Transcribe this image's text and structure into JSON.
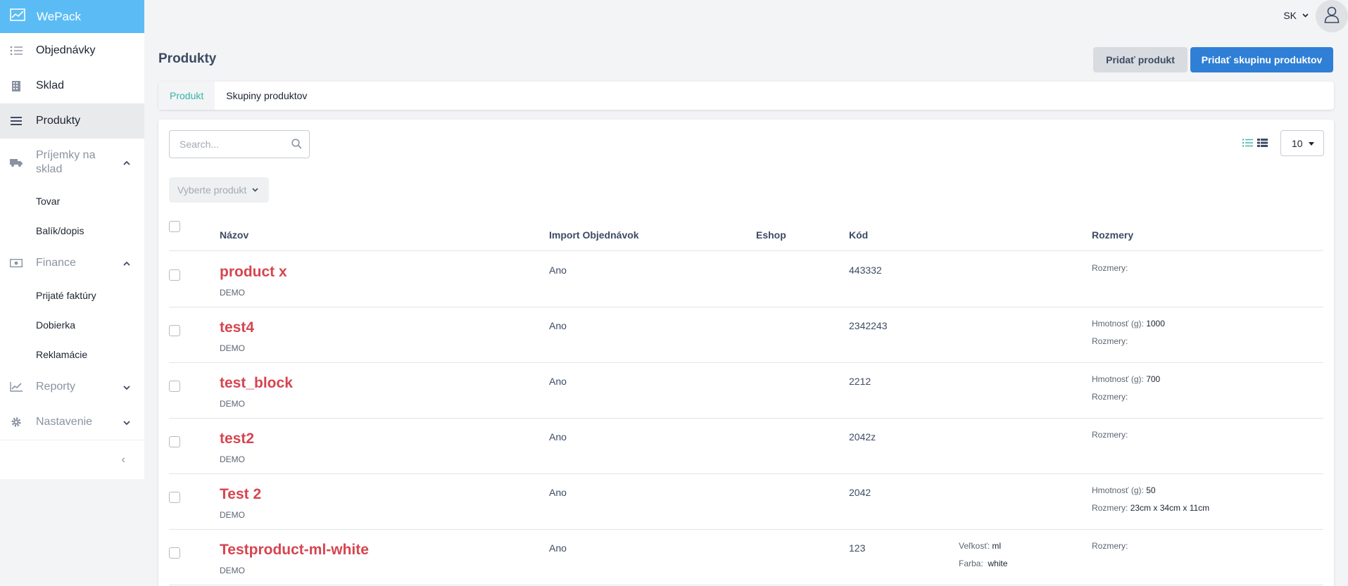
{
  "brand": {
    "name": "WePack"
  },
  "sidebar": {
    "items": [
      {
        "label": "Objednávky",
        "icon": "list-icon"
      },
      {
        "label": "Sklad",
        "icon": "building-icon"
      },
      {
        "label": "Produkty",
        "icon": "menu-icon"
      },
      {
        "label": "Príjemky na sklad",
        "icon": "truck-icon"
      }
    ],
    "prijemky_sub": [
      "Tovar",
      "Balík/dopis"
    ],
    "finance": {
      "label": "Finance",
      "icon": "money-icon",
      "sub": [
        "Prijaté faktúry",
        "Dobierka",
        "Reklamácie"
      ]
    },
    "reporty": {
      "label": "Reporty",
      "icon": "chart-line-icon"
    },
    "nastavenie": {
      "label": "Nastavenie",
      "icon": "gear-icon"
    },
    "collapse": "‹"
  },
  "header": {
    "language": "SK"
  },
  "page": {
    "title": "Produkty",
    "add_product": "Pridať produkt",
    "add_group": "Pridať skupinu produktov"
  },
  "tabs": [
    "Produkt",
    "Skupiny produktov"
  ],
  "toolbar": {
    "search_placeholder": "Search...",
    "page_size": "10",
    "select_product": "Vyberte produkt"
  },
  "table": {
    "headers": {
      "name": "Názov",
      "import": "Import Objednávok",
      "eshop": "Eshop",
      "code": "Kód",
      "dims": "Rozmery"
    },
    "rows": [
      {
        "name": "product x",
        "shop": "DEMO",
        "import": "Ano",
        "code": "443332",
        "weight_label": "",
        "weight": "",
        "dims_label": "Rozmery:",
        "dims": "",
        "size_label": "",
        "size": "",
        "color_label": "",
        "color": ""
      },
      {
        "name": "test4",
        "shop": "DEMO",
        "import": "Ano",
        "code": "2342243",
        "weight_label": "Hmotnosť (g):",
        "weight": "1000",
        "dims_label": "Rozmery:",
        "dims": "",
        "size_label": "",
        "size": "",
        "color_label": "",
        "color": ""
      },
      {
        "name": "test_block",
        "shop": "DEMO",
        "import": "Ano",
        "code": "2212",
        "weight_label": "Hmotnosť (g):",
        "weight": "700",
        "dims_label": "Rozmery:",
        "dims": "",
        "size_label": "",
        "size": "",
        "color_label": "",
        "color": ""
      },
      {
        "name": "test2",
        "shop": "DEMO",
        "import": "Ano",
        "code": "2042z",
        "weight_label": "",
        "weight": "",
        "dims_label": "Rozmery:",
        "dims": "",
        "size_label": "",
        "size": "",
        "color_label": "",
        "color": ""
      },
      {
        "name": "Test 2",
        "shop": "DEMO",
        "import": "Ano",
        "code": "2042",
        "weight_label": "Hmotnosť (g):",
        "weight": "50",
        "dims_label": "Rozmery:",
        "dims": "23cm x 34cm x 11cm",
        "size_label": "",
        "size": "",
        "color_label": "",
        "color": ""
      },
      {
        "name": "Testproduct-ml-white",
        "shop": "DEMO",
        "import": "Ano",
        "code": "123",
        "weight_label": "",
        "weight": "",
        "dims_label": "Rozmery:",
        "dims": "",
        "size_label": "Veľkosť:",
        "size": "ml",
        "color_label": "Farba:",
        "color": "white"
      }
    ]
  },
  "colors": {
    "brand": "#5bbcf5",
    "primary": "#2f7fd6",
    "product_name": "#d64550",
    "tab_active": "#39b2a7"
  }
}
